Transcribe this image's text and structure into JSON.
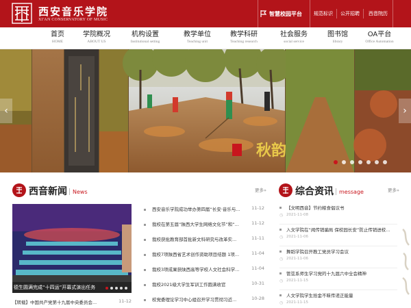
{
  "header": {
    "school_name_cn": "西安音乐学院",
    "school_name_en": "XI'AN CONSERVATORY OF MUSIC",
    "platform_label": "智慧校园平台",
    "links": [
      "规范标识",
      "公开招聘",
      "西音院历"
    ]
  },
  "nav": {
    "items": [
      {
        "cn": "首页",
        "en": "HOME"
      },
      {
        "cn": "学院概况",
        "en": "ABOUT US"
      },
      {
        "cn": "机构设置",
        "en": "Institutional setting"
      },
      {
        "cn": "教学单位",
        "en": "Teaching unit"
      },
      {
        "cn": "教学科研",
        "en": "Teaching research"
      },
      {
        "cn": "社会服务",
        "en": "social service"
      },
      {
        "cn": "图书馆",
        "en": "library"
      },
      {
        "cn": "OA平台",
        "en": "Office Automation"
      }
    ]
  },
  "banner": {
    "slide_count": 7,
    "active_slide": 1,
    "calligraphy": "秋韵",
    "colors": {
      "trees": "#8a9a3a",
      "leaves": "#a9622b",
      "road": "#c49a6c"
    }
  },
  "news": {
    "title": "西音新闻",
    "subtitle": "News",
    "more": "更多»",
    "photo_caption": "德生圆满完成“十四运”开幕式演出任务",
    "photo_news": {
      "title": "【转载】中国共产党第十九届中央委员会...",
      "date": "11-12"
    },
    "items": [
      {
        "title": "西安音乐学院成功举办第四届“长安·音乐与...",
        "date": "11-12"
      },
      {
        "title": "我校在第五届“陕西大学生网络文化节”和“...",
        "date": "11-12"
      },
      {
        "title": "我校获批教育部首批新文科研究与改革实...",
        "date": "11-11"
      },
      {
        "title": "我校7项陕西省艺术创作资助项目结题 1项...",
        "date": "11-04"
      },
      {
        "title": "我校3项成果获陕西高等学校人文社会科学...",
        "date": "11-04"
      },
      {
        "title": "我校2021级大学生军训工作圆满收官",
        "date": "10-31"
      },
      {
        "title": "校党委理论学习中心组召开学习贯彻习近...",
        "date": "10-28"
      }
    ]
  },
  "message": {
    "title": "综合资讯",
    "subtitle": "message",
    "more": "更多»",
    "items": [
      {
        "title": "【文明西音】节约粮食倡议书",
        "date": "2021-11-08"
      },
      {
        "title": "入文学院在“闻传销骗局 保校园长安”防止传销进校...",
        "date": "2021-11-06"
      },
      {
        "title": "舞蹈学院召开教工党员学习会议",
        "date": "2021-11-06"
      },
      {
        "title": "管弦系师生学习党的十九届六中全会精神",
        "date": "2021-11-15"
      },
      {
        "title": "人文学院学生拾金不昧传递正能量",
        "date": "2021-11-15"
      }
    ]
  },
  "colors": {
    "brand_red": "#b3141a",
    "accent_red": "#c8161d"
  }
}
